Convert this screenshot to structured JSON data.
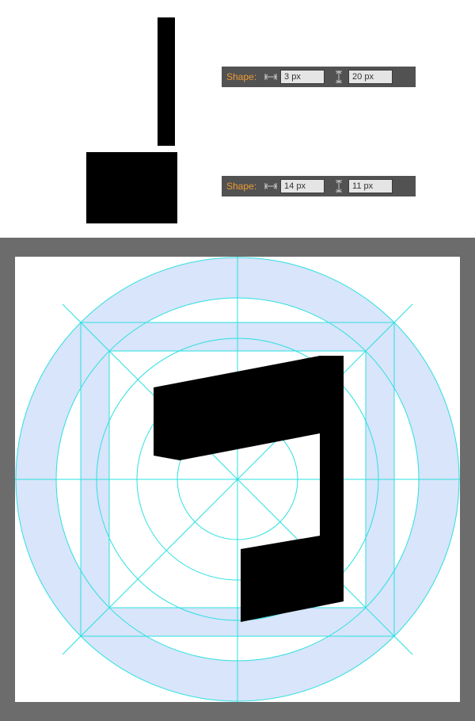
{
  "panel1": {
    "label": "Shape:",
    "width": "3 px",
    "height": "20 px"
  },
  "panel2": {
    "label": "Shape:",
    "width": "14 px",
    "height": "11 px"
  },
  "icons": {
    "width": "width-icon",
    "height": "height-icon"
  }
}
